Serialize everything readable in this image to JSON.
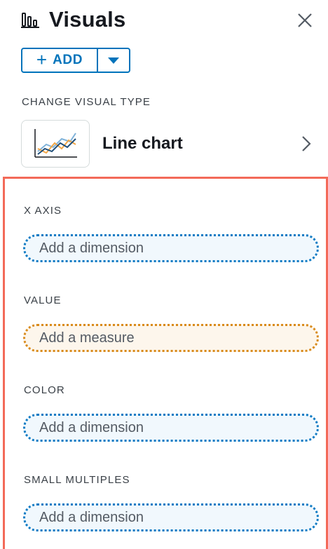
{
  "header": {
    "title": "Visuals",
    "icon": "bar-chart-icon",
    "close_icon": "close-icon"
  },
  "add_button": {
    "label": "ADD",
    "icon": "plus-icon",
    "dropdown_icon": "caret-down-icon"
  },
  "visual_type": {
    "section_label": "CHANGE VISUAL TYPE",
    "name": "Line chart",
    "thumbnail_icon": "line-chart-icon",
    "chevron_icon": "chevron-right-icon"
  },
  "field_wells": [
    {
      "label": "X AXIS",
      "placeholder": "Add a dimension",
      "kind": "dimension"
    },
    {
      "label": "VALUE",
      "placeholder": "Add a measure",
      "kind": "measure"
    },
    {
      "label": "COLOR",
      "placeholder": "Add a dimension",
      "kind": "dimension"
    },
    {
      "label": "SMALL MULTIPLES",
      "placeholder": "Add a dimension",
      "kind": "dimension"
    }
  ],
  "colors": {
    "accent": "#0073bb",
    "dimension_border": "#0f7bc4",
    "measure_border": "#d98b1c",
    "highlight_border": "#f36a59"
  }
}
